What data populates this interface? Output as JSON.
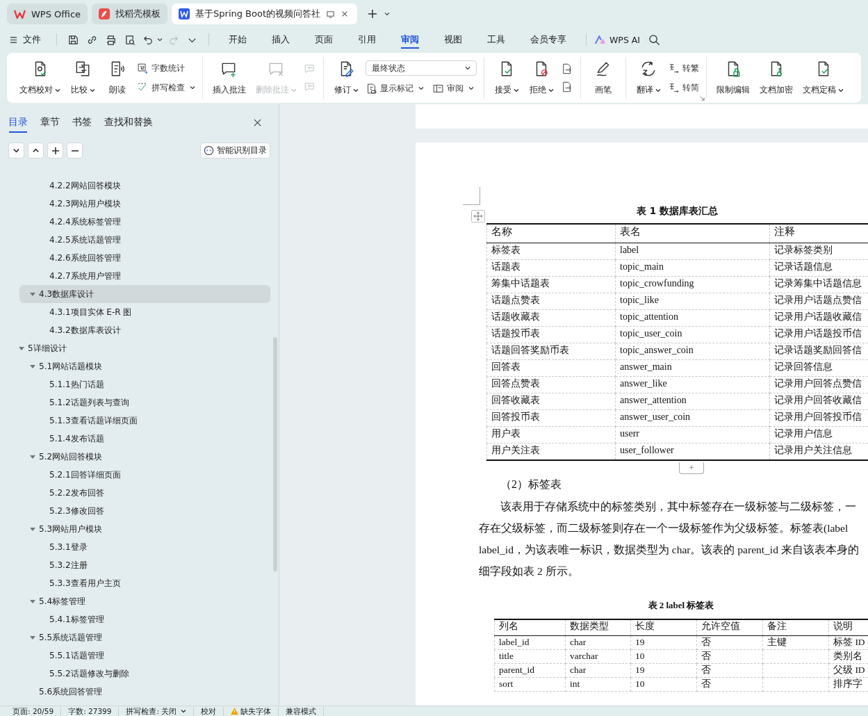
{
  "title_bar": {
    "tabs": [
      {
        "kind": "home",
        "label": "WPS Office",
        "selected": false
      },
      {
        "kind": "template",
        "label": "找稻壳模板",
        "selected": false
      },
      {
        "kind": "document",
        "label": "基于Spring Boot的视频问答社",
        "selected": true
      }
    ]
  },
  "menu_bar": {
    "file_menu": "文件",
    "quick_access": [
      {
        "kind": "save",
        "disabled": false
      },
      {
        "kind": "share",
        "disabled": false
      },
      {
        "kind": "print",
        "disabled": false
      },
      {
        "kind": "preview",
        "disabled": false
      },
      {
        "kind": "undo",
        "disabled": false
      },
      {
        "kind": "redo",
        "disabled": true
      },
      {
        "kind": "more",
        "disabled": false
      }
    ],
    "tabs": [
      {
        "label": "开始",
        "selected": false
      },
      {
        "label": "插入",
        "selected": false
      },
      {
        "label": "页面",
        "selected": false
      },
      {
        "label": "引用",
        "selected": false
      },
      {
        "label": "审阅",
        "selected": true
      },
      {
        "label": "视图",
        "selected": false
      },
      {
        "label": "工具",
        "selected": false
      },
      {
        "label": "会员专享",
        "selected": false
      }
    ],
    "ai_button": "WPS AI"
  },
  "ribbon": {
    "groups": [
      {
        "items": [
          {
            "kind": "large",
            "label": "文档校对",
            "dropdown": true,
            "disabled": false
          },
          {
            "kind": "large",
            "label": "比较",
            "dropdown": true,
            "disabled": false
          },
          {
            "kind": "large",
            "label": "朗读",
            "dropdown": false,
            "disabled": false
          },
          {
            "kind": "stack",
            "items": [
              {
                "kind": "small",
                "label": "字数统计",
                "dropdown": false,
                "disabled": false
              },
              {
                "kind": "small",
                "label": "拼写检查",
                "dropdown": true,
                "disabled": false
              }
            ]
          }
        ]
      },
      {
        "items": [
          {
            "kind": "large",
            "label": "插入批注",
            "dropdown": false,
            "disabled": false
          },
          {
            "kind": "large",
            "label": "删除批注",
            "dropdown": true,
            "disabled": true
          },
          {
            "kind": "stack",
            "items": [
              {
                "kind": "icon",
                "disabled": true
              },
              {
                "kind": "icon",
                "disabled": true
              }
            ]
          }
        ]
      },
      {
        "items": [
          {
            "kind": "large",
            "label": "修订",
            "dropdown": true,
            "disabled": false
          },
          {
            "kind": "stack",
            "items": [
              {
                "kind": "select",
                "value": "最终状态"
              },
              {
                "kind": "row",
                "items": [
                  {
                    "kind": "small",
                    "label": "显示标记",
                    "dropdown": true,
                    "disabled": false
                  },
                  {
                    "kind": "small",
                    "label": "审阅",
                    "dropdown": true,
                    "disabled": false
                  }
                ]
              }
            ]
          }
        ]
      },
      {
        "items": [
          {
            "kind": "large",
            "label": "接受",
            "dropdown": true,
            "disabled": false
          },
          {
            "kind": "large",
            "label": "拒绝",
            "dropdown": true,
            "disabled": false
          },
          {
            "kind": "stack",
            "items": [
              {
                "kind": "icon",
                "disabled": false
              },
              {
                "kind": "icon",
                "disabled": false
              }
            ]
          }
        ]
      },
      {
        "items": [
          {
            "kind": "large",
            "label": "画笔",
            "dropdown": false,
            "disabled": false
          }
        ]
      },
      {
        "items": [
          {
            "kind": "large",
            "label": "翻译",
            "dropdown": true,
            "disabled": false
          },
          {
            "kind": "stack",
            "items": [
              {
                "kind": "small",
                "label": "转繁",
                "dropdown": false,
                "disabled": false
              },
              {
                "kind": "small",
                "label": "转简",
                "dropdown": false,
                "disabled": false
              }
            ]
          }
        ]
      },
      {
        "items": [
          {
            "kind": "large",
            "label": "限制编辑",
            "dropdown": false,
            "disabled": false
          },
          {
            "kind": "large",
            "label": "文档加密",
            "dropdown": false,
            "disabled": false
          },
          {
            "kind": "large",
            "label": "文档定稿",
            "dropdown": true,
            "disabled": false
          }
        ]
      }
    ]
  },
  "navigation_pane": {
    "tabs": [
      {
        "label": "目录",
        "selected": true
      },
      {
        "label": "章节",
        "selected": false
      },
      {
        "label": "书签",
        "selected": false
      },
      {
        "label": "查找和替换",
        "selected": false
      }
    ],
    "smart_toc_button": "智能识别目录",
    "toc": [
      {
        "children": [
          {
            "children": [
              {
                "label": "4.2.2网站回答模块",
                "selected": false
              },
              {
                "label": "4.2.3网站用户模块",
                "selected": false
              },
              {
                "label": "4.2.4系统标签管理",
                "selected": false
              },
              {
                "label": "4.2.5系统话题管理",
                "selected": false
              },
              {
                "label": "4.2.6系统回答管理",
                "selected": false
              },
              {
                "label": "4.2.7系统用户管理",
                "selected": false
              }
            ]
          },
          {
            "label": "4.3数据库设计",
            "selected": true,
            "expanded": true,
            "children": [
              {
                "label": "4.3.1项目实体 E-R 图",
                "selected": false
              },
              {
                "label": "4.3.2数据库表设计",
                "selected": false
              }
            ]
          }
        ]
      },
      {
        "label": "5详细设计",
        "selected": false,
        "expanded": true,
        "children": [
          {
            "label": "5.1网站话题模块",
            "selected": false,
            "expanded": true,
            "children": [
              {
                "label": "5.1.1热门话题",
                "selected": false
              },
              {
                "label": "5.1.2话题列表与查询",
                "selected": false
              },
              {
                "label": "5.1.3查看话题详细页面",
                "selected": false
              },
              {
                "label": "5.1.4发布话题",
                "selected": false
              }
            ]
          },
          {
            "label": "5.2网站回答模块",
            "selected": false,
            "expanded": true,
            "children": [
              {
                "label": "5.2.1回答详细页面",
                "selected": false
              },
              {
                "label": "5.2.2发布回答",
                "selected": false
              },
              {
                "label": "5.2.3修改回答",
                "selected": false
              }
            ]
          },
          {
            "label": "5.3网站用户模块",
            "selected": false,
            "expanded": true,
            "children": [
              {
                "label": "5.3.1登录",
                "selected": false
              },
              {
                "label": "5.3.2注册",
                "selected": false
              },
              {
                "label": "5.3.3查看用户主页",
                "selected": false
              }
            ]
          },
          {
            "label": "5.4标签管理",
            "selected": false,
            "expanded": true,
            "children": [
              {
                "label": "5.4.1标签管理",
                "selected": false
              }
            ]
          },
          {
            "label": "5.5系统话题管理",
            "selected": false,
            "expanded": true,
            "children": [
              {
                "label": "5.5.1话题管理",
                "selected": false
              },
              {
                "label": "5.5.2话题修改与删除",
                "selected": false
              }
            ]
          },
          {
            "label": "5.6系统回答管理",
            "selected": false
          }
        ]
      }
    ]
  },
  "document": {
    "table_1": {
      "caption": "表 1  数据库表汇总",
      "columns": [
        "名称",
        "表名",
        "注释"
      ],
      "rows": [
        [
          "标签表",
          "label",
          "记录标签类别"
        ],
        [
          "话题表",
          "topic_main",
          "记录话题信息"
        ],
        [
          "筹集中话题表",
          "topic_crowfunding",
          "记录筹集中话题信息"
        ],
        [
          "话题点赞表",
          "topic_like",
          "记录用户话题点赞信"
        ],
        [
          "话题收藏表",
          "topic_attention",
          "记录用户话题收藏信"
        ],
        [
          "话题投币表",
          "topic_user_coin",
          "记录用户话题投币信"
        ],
        [
          "话题回答奖励币表",
          "topic_answer_coin",
          "记录话题奖励回答信"
        ],
        [
          "回答表",
          "answer_main",
          "记录回答信息"
        ],
        [
          "回答点赞表",
          "answer_like",
          "记录用户回答点赞信"
        ],
        [
          "回答收藏表",
          "answer_attention",
          "记录用户回答收藏信"
        ],
        [
          "回答投币表",
          "answer_user_coin",
          "记录用户回答投币信"
        ],
        [
          "用户表",
          "userr",
          "记录用户信息"
        ],
        [
          "用户关注表",
          "user_follower",
          "记录用户关注信息"
        ]
      ]
    },
    "add_row_button": "+",
    "heading": "（2）标签表",
    "paragraph_lines": [
      "该表用于存储系统中的标签类别，其中标签存在一级标签与二级标签，一",
      "存在父级标签，而二级标签则存在一个一级标签作为父级标签。标签表(label",
      "label_id，为该表唯一标识，数据类型为 char。该表的 parent_id 来自该表本身的",
      "细字段如表 2 所示。"
    ],
    "table_2": {
      "caption": "表 2 label 标签表",
      "columns": [
        "列名",
        "数据类型",
        "长度",
        "允许空值",
        "备注",
        "说明"
      ],
      "rows": [
        [
          "label_id",
          "char",
          "19",
          "否",
          "主键",
          "标签 ID"
        ],
        [
          "title",
          "varchar",
          "10",
          "否",
          "",
          "类别名"
        ],
        [
          "parent_id",
          "char",
          "19",
          "否",
          "",
          "父级 ID"
        ],
        [
          "sort",
          "int",
          "10",
          "否",
          "",
          "排序字"
        ]
      ]
    }
  },
  "status_bar": {
    "items": [
      {
        "kind": "text",
        "label": "页面: 20/59"
      },
      {
        "kind": "text",
        "label": "字数: 27399"
      },
      {
        "kind": "dropdown",
        "label": "拼写检查: 关闭"
      },
      {
        "kind": "text",
        "label": "校对"
      },
      {
        "kind": "warning",
        "label": "缺失字体"
      },
      {
        "kind": "text",
        "label": "兼容模式"
      }
    ]
  }
}
